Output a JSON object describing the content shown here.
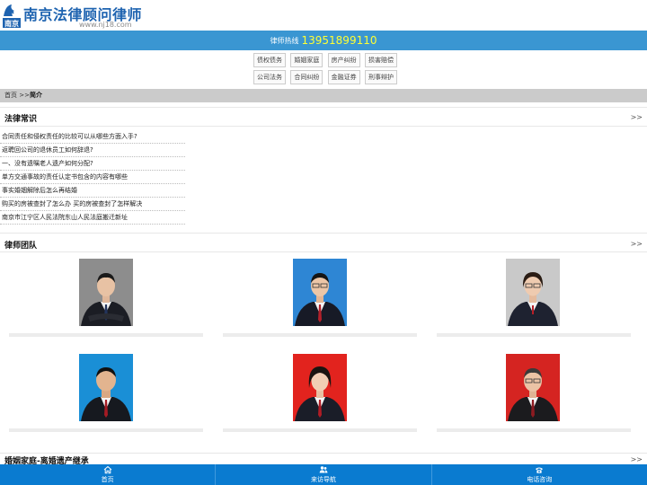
{
  "site": {
    "title": "南京法律顾问律师",
    "url": "www.nj18.com",
    "logo_mark": "南京"
  },
  "hotline": {
    "label": "律师热线",
    "number": "13951899110"
  },
  "categories": [
    [
      "债权债务",
      "婚姻家庭",
      "房产纠纷",
      "损害赔偿"
    ],
    [
      "公司法务",
      "合同纠纷",
      "金融证券",
      "刑事辩护"
    ]
  ],
  "breadcrumb": {
    "home": "首页",
    "sep": ">>",
    "current": "简介"
  },
  "legal_knowledge": {
    "title": "法律常识",
    "more": ">>",
    "items": [
      "合同责任和侵权责任的比较可以从哪些方面入手?",
      "返聘回公司的退休员工如何辞退?",
      "一、没有遗嘱老人遗产如何分配?",
      "单方交通事故的责任认定书包含的内容有哪些",
      "事实婚姻解除后怎么再结婚",
      "购买的房被查封了怎么办 买的房被查封了怎样解决",
      "南京市江宁区人民法院东山人民法庭搬迁新址"
    ]
  },
  "lawyer_team": {
    "title": "律师团队",
    "more": ">>"
  },
  "bottom_section": {
    "title": "婚姻家庭-离婚遗产继承",
    "more": ">>"
  },
  "footer": [
    {
      "label": "首页",
      "icon": "home-icon"
    },
    {
      "label": "来访导航",
      "icon": "users-icon"
    },
    {
      "label": "电话咨询",
      "icon": "phone-icon"
    }
  ],
  "colors": {
    "brand_blue": "#1e63b0",
    "hotline_bar": "#3a96d2",
    "hotline_number": "#ffff33",
    "footer_bar": "#0a7bd0"
  }
}
